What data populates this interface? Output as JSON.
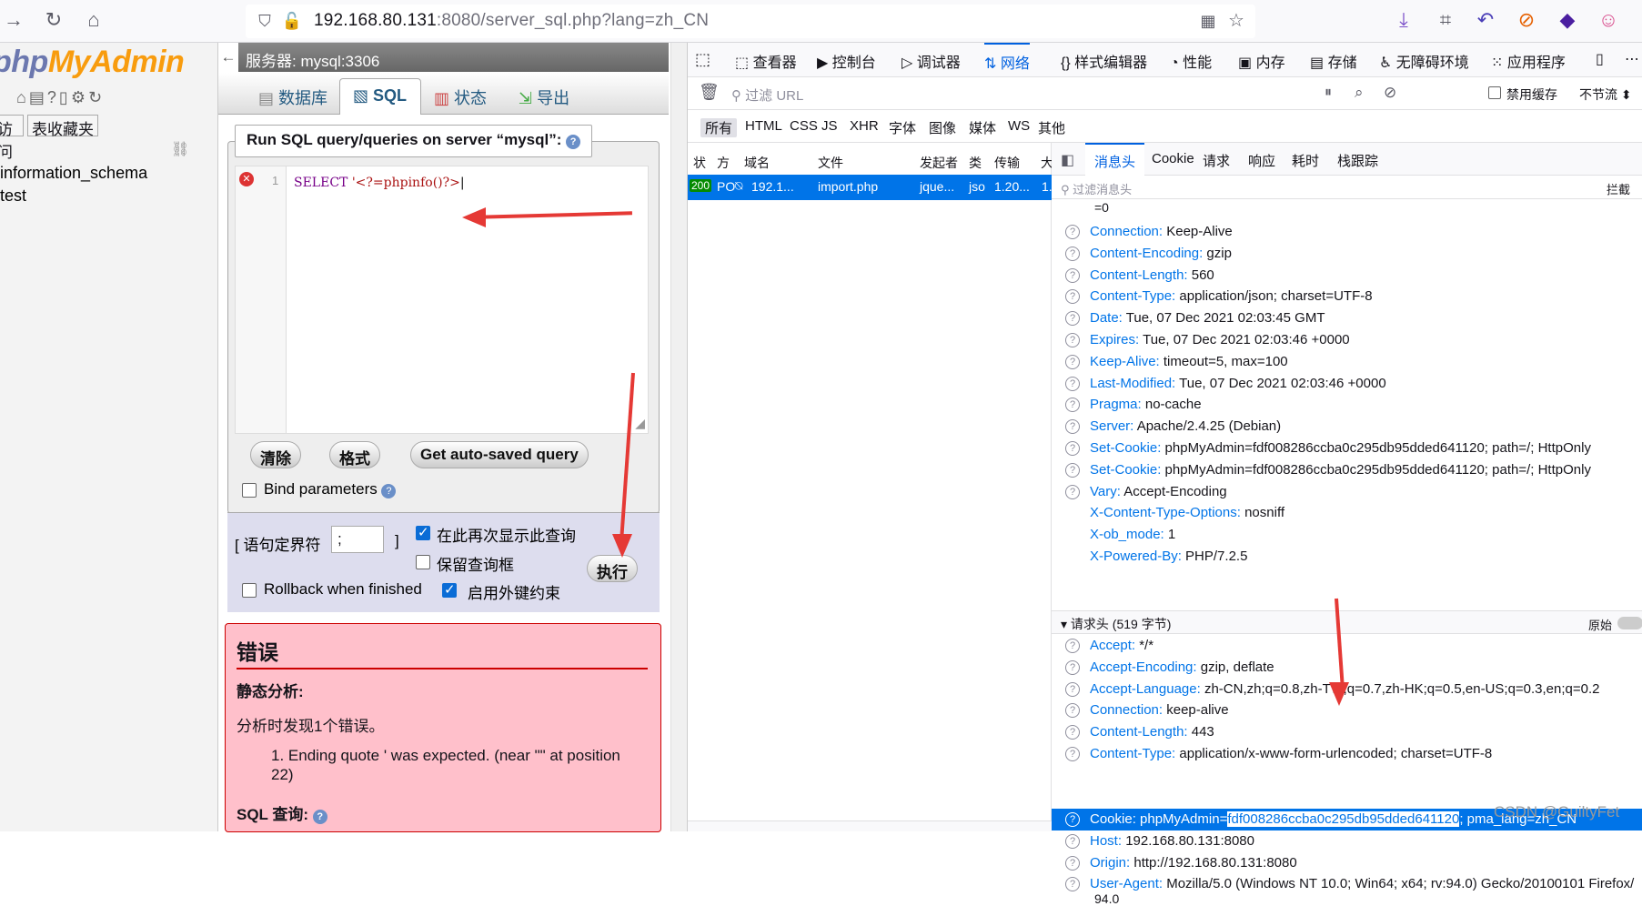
{
  "browser": {
    "url_host": "192.168.80.131",
    "url_rest": ":8080/server_sql.php?lang=zh_CN"
  },
  "pma_nav": {
    "logo_php": "php",
    "logo_myadmin": "MyAdmin",
    "tab_recent": "访问",
    "tab_favorites": "表收藏夹",
    "databases": [
      "information_schema",
      "test"
    ]
  },
  "pma_main": {
    "server": "服务器: mysql:3306",
    "tabs": [
      "数据库",
      "SQL",
      "状态",
      "导出"
    ],
    "legend": "Run SQL query/queries on server “mysql”:",
    "line_number": "1",
    "query_prefix": "SELECT ",
    "query_string": "'<?=phpinfo()?>",
    "btn_clear": "清除",
    "btn_format": "格式",
    "btn_autosaved": "Get auto-saved query",
    "bind_params": "Bind parameters",
    "delimiter_label": "[ 语句定界符",
    "delimiter_value": ";",
    "delimiter_close": "]",
    "show_again": "在此再次显示此查询",
    "keep_box": "保留查询框",
    "rollback": "Rollback when finished",
    "fk_checks": "启用外键约束",
    "btn_go": "执行",
    "error_title": "错误",
    "static_analysis": "静态分析:",
    "found_errors": "分析时发现1个错误。",
    "error_item": "1. Ending quote ' was expected. (near \"\" at position 22)",
    "sql_query_label": "SQL 查询:"
  },
  "devtools": {
    "tabs": [
      "查看器",
      "控制台",
      "调试器",
      "网络",
      "样式编辑器",
      "性能",
      "内存",
      "存储",
      "无障碍环境",
      "应用程序"
    ],
    "filter_placeholder": "过滤 URL",
    "disable_cache": "禁用缓存",
    "throttle": "不节流 ⬍",
    "types": [
      "所有",
      "HTML",
      "CSS",
      "JS",
      "XHR",
      "字体",
      "图像",
      "媒体",
      "WS",
      "其他"
    ],
    "columns": [
      "状",
      "方",
      "域名",
      "文件",
      "发起者",
      "类",
      "传输",
      "大"
    ],
    "request": {
      "status": "200",
      "method": "PO",
      "domain": "192.1...",
      "file": "import.php",
      "initiator": "jque...",
      "type": "jso",
      "transfer": "1.20...",
      "size": "1."
    },
    "detail_tabs": [
      "消息头",
      "Cookie",
      "请求",
      "响应",
      "耗时",
      "栈跟踪"
    ],
    "header_filter": "过滤消息头",
    "block": "拦截",
    "partial_line": "=0",
    "response_headers": [
      {
        "k": "Connection:",
        "v": "Keep-Alive"
      },
      {
        "k": "Content-Encoding:",
        "v": "gzip"
      },
      {
        "k": "Content-Length:",
        "v": "560"
      },
      {
        "k": "Content-Type:",
        "v": "application/json; charset=UTF-8"
      },
      {
        "k": "Date:",
        "v": "Tue, 07 Dec 2021 02:03:45 GMT"
      },
      {
        "k": "Expires:",
        "v": "Tue, 07 Dec 2021 02:03:46 +0000"
      },
      {
        "k": "Keep-Alive:",
        "v": "timeout=5, max=100"
      },
      {
        "k": "Last-Modified:",
        "v": "Tue, 07 Dec 2021 02:03:46 +0000"
      },
      {
        "k": "Pragma:",
        "v": "no-cache"
      },
      {
        "k": "Server:",
        "v": "Apache/2.4.25 (Debian)"
      },
      {
        "k": "Set-Cookie:",
        "v": "phpMyAdmin=fdf008286ccba0c295db95dded641120; path=/; HttpOnly"
      },
      {
        "k": "Set-Cookie:",
        "v": "phpMyAdmin=fdf008286ccba0c295db95dded641120; path=/; HttpOnly"
      },
      {
        "k": "Vary:",
        "v": "Accept-Encoding"
      },
      {
        "k": "X-Content-Type-Options:",
        "v": "nosniff"
      },
      {
        "k": "X-ob_mode:",
        "v": "1"
      },
      {
        "k": "X-Powered-By:",
        "v": "PHP/7.2.5"
      }
    ],
    "request_section": "请求头 (519 字节)",
    "raw": "原始",
    "request_headers": [
      {
        "k": "Accept:",
        "v": "*/*"
      },
      {
        "k": "Accept-Encoding:",
        "v": "gzip, deflate"
      },
      {
        "k": "Accept-Language:",
        "v": "zh-CN,zh;q=0.8,zh-TW;q=0.7,zh-HK;q=0.5,en-US;q=0.3,en;q=0.2"
      },
      {
        "k": "Connection:",
        "v": "keep-alive"
      },
      {
        "k": "Content-Length:",
        "v": "443"
      },
      {
        "k": "Content-Type:",
        "v": "application/x-www-form-urlencoded; charset=UTF-8"
      }
    ],
    "cookie_key": "Cookie:",
    "cookie_prefix": "phpMyAdmin=",
    "cookie_value": "fdf008286ccba0c295db95dded641120",
    "cookie_suffix": "; pma_lang=zh_CN",
    "request_headers_2": [
      {
        "k": "Host:",
        "v": "192.168.80.131:8080"
      },
      {
        "k": "Origin:",
        "v": "http://192.168.80.131:8080"
      },
      {
        "k": "User-Agent:",
        "v": "Mozilla/5.0 (Windows NT 10.0; Win64; x64; rv:94.0) Gecko/20100101 Firefox/"
      }
    ],
    "ua_cont": "94.0",
    "watermark": "CSDN @GuiltyFet"
  }
}
